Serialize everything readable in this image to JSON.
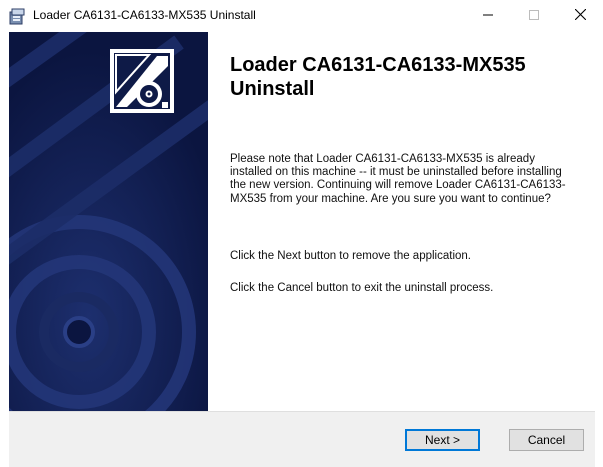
{
  "window": {
    "title": "Loader CA6131-CA6133-MX535 Uninstall",
    "app_icon": "installer-box-icon",
    "controls": {
      "minimize_icon": "minimize-icon",
      "maximize_icon": "maximize-icon",
      "close_icon": "close-icon"
    }
  },
  "banner": {
    "logo_icon": "cd-installer-logo-icon",
    "background_color": "#0e1a47"
  },
  "main": {
    "heading": "Loader CA6131-CA6133-MX535 Uninstall",
    "paragraphs": [
      "Please note that Loader CA6131-CA6133-MX535 is already installed on this machine -- it must be uninstalled before installing the new version. Continuing will remove Loader CA6131-CA6133-MX535 from your machine. Are you sure you want to continue?",
      "Click the Next button to remove the application.",
      "Click the Cancel button to exit the uninstall process."
    ]
  },
  "footer": {
    "next_label": "Next >",
    "cancel_label": "Cancel",
    "accent_color": "#0078d7"
  }
}
